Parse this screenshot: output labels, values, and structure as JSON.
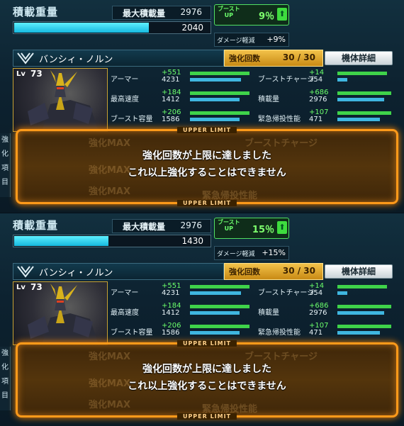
{
  "panels": [
    {
      "load": {
        "title": "積載重量",
        "max_label": "最大積載量",
        "max_value": "2976",
        "current_value": "2040",
        "fill_percent": 68.5
      },
      "boost": {
        "label_top": "ブースト",
        "label_bottom": "UP",
        "value": "9％",
        "arrow": "⬆"
      },
      "damage": {
        "label": "ダメージ軽減",
        "value": "+9%"
      },
      "unit": {
        "name": "バンシィ・ノルン"
      },
      "enhance": {
        "label": "強化回数",
        "value": "30 / 30"
      },
      "detail_label": "機体詳細",
      "level": {
        "label": "Lv",
        "value": "73"
      },
      "stats": [
        {
          "name": "アーマー",
          "plus": "+551",
          "base": "4231"
        },
        {
          "name": "最高速度",
          "plus": "+184",
          "base": "1412"
        },
        {
          "name": "ブースト容量",
          "plus": "+206",
          "base": "1586"
        },
        {
          "name": "ブーストチャージ",
          "plus": "+14",
          "base": "354"
        },
        {
          "name": "積載量",
          "plus": "+686",
          "base": "2976"
        },
        {
          "name": "緊急帰投性能",
          "plus": "+107",
          "base": "471"
        }
      ],
      "overlay": {
        "tag": "UPPER LIMIT",
        "line1": "強化回数が上限に達しました",
        "line2": "これ以上強化することはできません"
      },
      "side_tab": [
        "強",
        "化",
        "項",
        "目"
      ]
    },
    {
      "load": {
        "title": "積載重量",
        "max_label": "最大積載量",
        "max_value": "2976",
        "current_value": "1430",
        "fill_percent": 48
      },
      "boost": {
        "label_top": "ブースト",
        "label_bottom": "UP",
        "value": "15％",
        "arrow": "⬆"
      },
      "damage": {
        "label": "ダメージ軽減",
        "value": "+15%"
      },
      "unit": {
        "name": "バンシィ・ノルン"
      },
      "enhance": {
        "label": "強化回数",
        "value": "30 / 30"
      },
      "detail_label": "機体詳細",
      "level": {
        "label": "Lv",
        "value": "73"
      },
      "stats": [
        {
          "name": "アーマー",
          "plus": "+551",
          "base": "4231"
        },
        {
          "name": "最高速度",
          "plus": "+184",
          "base": "1412"
        },
        {
          "name": "ブースト容量",
          "plus": "+206",
          "base": "1586"
        },
        {
          "name": "ブーストチャージ",
          "plus": "+14",
          "base": "354"
        },
        {
          "name": "積載量",
          "plus": "+686",
          "base": "2976"
        },
        {
          "name": "緊急帰投性能",
          "plus": "+107",
          "base": "471"
        }
      ],
      "overlay": {
        "tag": "UPPER LIMIT",
        "line1": "強化回数が上限に達しました",
        "line2": "これ以上強化することはできません"
      },
      "side_tab": [
        "強",
        "化",
        "項",
        "目"
      ]
    }
  ],
  "background_rows": [
    "強化MAX",
    "強化MAX",
    "強化MAX",
    "ブーストチャージ",
    "緊急帰投性能"
  ],
  "colors": {
    "accent_orange": "#ff9a1a",
    "boost_green": "#6bff6b",
    "load_cyan": "#16b9df",
    "enhance_gold": "#f3c24a"
  }
}
